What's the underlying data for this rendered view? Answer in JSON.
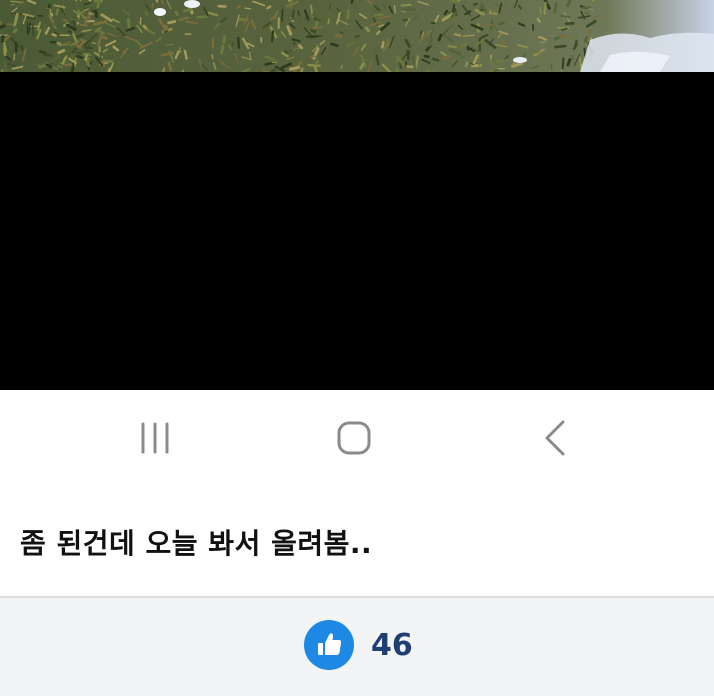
{
  "post": {
    "caption": "좀 된건데 오늘 봐서 올려봄.."
  },
  "reactions": {
    "like_count": "46",
    "like_icon": "thumbs-up-icon",
    "like_color": "#1e88e5"
  },
  "navigation_bar": {
    "icons": [
      "recent-apps-icon",
      "home-icon",
      "back-icon"
    ]
  },
  "colors": {
    "black_area": "#000000",
    "footer_background": "#f3f4f6",
    "count_text": "#1f3f73"
  }
}
